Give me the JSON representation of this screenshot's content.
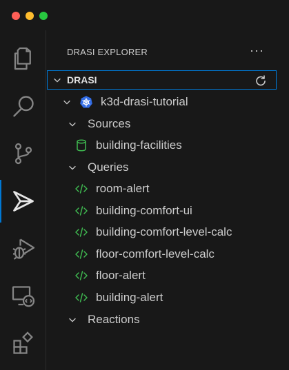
{
  "window": {
    "controls": [
      "close",
      "minimize",
      "zoom"
    ]
  },
  "activity_bar": {
    "items": [
      {
        "name": "explorer",
        "icon": "files-icon"
      },
      {
        "name": "search",
        "icon": "search-icon"
      },
      {
        "name": "source-control",
        "icon": "source-control-icon"
      },
      {
        "name": "drasi",
        "icon": "drasi-icon",
        "active": true
      },
      {
        "name": "run-debug",
        "icon": "run-debug-icon"
      },
      {
        "name": "remote-explorer",
        "icon": "remote-explorer-icon"
      },
      {
        "name": "extensions",
        "icon": "extensions-icon"
      }
    ]
  },
  "sidebar": {
    "title": "DRASI EXPLORER",
    "more_label": "···",
    "section": {
      "label": "DRASI",
      "refresh_icon": "refresh-icon"
    },
    "tree": {
      "cluster": {
        "label": "k3d-drasi-tutorial",
        "icon": "kubernetes-icon"
      },
      "sources": {
        "label": "Sources",
        "items": [
          {
            "label": "building-facilities",
            "icon": "database-icon"
          }
        ]
      },
      "queries": {
        "label": "Queries",
        "items": [
          {
            "label": "room-alert",
            "icon": "code-icon"
          },
          {
            "label": "building-comfort-ui",
            "icon": "code-icon"
          },
          {
            "label": "building-comfort-level-calc",
            "icon": "code-icon"
          },
          {
            "label": "floor-comfort-level-calc",
            "icon": "code-icon"
          },
          {
            "label": "floor-alert",
            "icon": "code-icon"
          },
          {
            "label": "building-alert",
            "icon": "code-icon"
          }
        ]
      },
      "reactions": {
        "label": "Reactions",
        "items": []
      }
    }
  },
  "colors": {
    "background": "#181818",
    "text": "#cccccc",
    "accent": "#0078d4",
    "icon_green": "#3fb950",
    "kubernetes_blue": "#326ce5"
  }
}
